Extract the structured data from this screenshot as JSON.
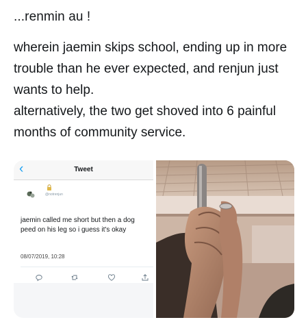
{
  "post": {
    "title": "...renmin au !",
    "paragraph1": "wherein jaemin skips school, ending up in more trouble than he ever expected, and renjun just wants to help.",
    "paragraph2": "alternatively, the two get shoved into 6 painful months of community service."
  },
  "tweet": {
    "back_icon": "chevron-left-icon",
    "header": "Tweet",
    "handle": "@notrenjun",
    "text": "jaemin called me short but then a dog peed on his leg so i guess it's okay",
    "timestamp": "08/07/2019, 10:28",
    "colors": {
      "accent": "#1da1f2",
      "muted": "#8899a6"
    }
  },
  "icons": [
    "lock-icon",
    "reply-icon",
    "retweet-icon",
    "like-icon",
    "share-icon"
  ]
}
